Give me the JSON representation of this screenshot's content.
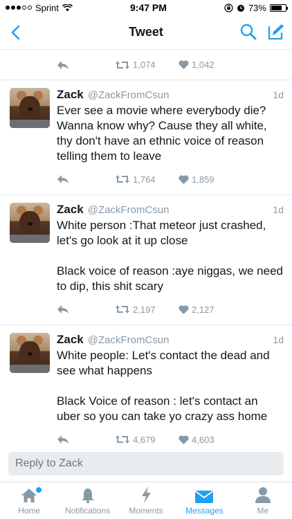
{
  "status_bar": {
    "carrier": "Sprint",
    "time": "9:47 PM",
    "battery_percent": "73%",
    "battery_level": 0.73
  },
  "nav": {
    "title": "Tweet"
  },
  "first_tweet_actions": {
    "retweets": "1,074",
    "likes": "1,042"
  },
  "tweets": [
    {
      "name": "Zack",
      "handle": "@ZackFromCsun",
      "time": "1d",
      "text": "Ever see a movie where everybody die? Wanna know why? Cause they all white, thy don't have an ethnic voice of reason telling them to leave",
      "retweets": "1,764",
      "likes": "1,859"
    },
    {
      "name": "Zack",
      "handle": "@ZackFromCsun",
      "time": "1d",
      "text": "White person :That meteor just crashed, let's go look at it up close\n\nBlack voice of reason :aye niggas, we need to dip, this shit scary",
      "retweets": "2,197",
      "likes": "2,127"
    },
    {
      "name": "Zack",
      "handle": "@ZackFromCsun",
      "time": "1d",
      "text": "White people: Let's contact the dead and see what happens\n\nBlack Voice of reason : let's contact an uber so you can take yo crazy ass home",
      "retweets": "4,679",
      "likes": "4,603"
    }
  ],
  "reply": {
    "placeholder": "Reply to Zack"
  },
  "tabs": [
    {
      "label": "Home",
      "icon": "home-icon"
    },
    {
      "label": "Notifications",
      "icon": "bell-icon"
    },
    {
      "label": "Moments",
      "icon": "lightning-icon"
    },
    {
      "label": "Messages",
      "icon": "envelope-icon"
    },
    {
      "label": "Me",
      "icon": "person-icon"
    }
  ],
  "colors": {
    "accent": "#1da1f2",
    "muted": "#8899a6",
    "divider": "#e1e8ed"
  }
}
